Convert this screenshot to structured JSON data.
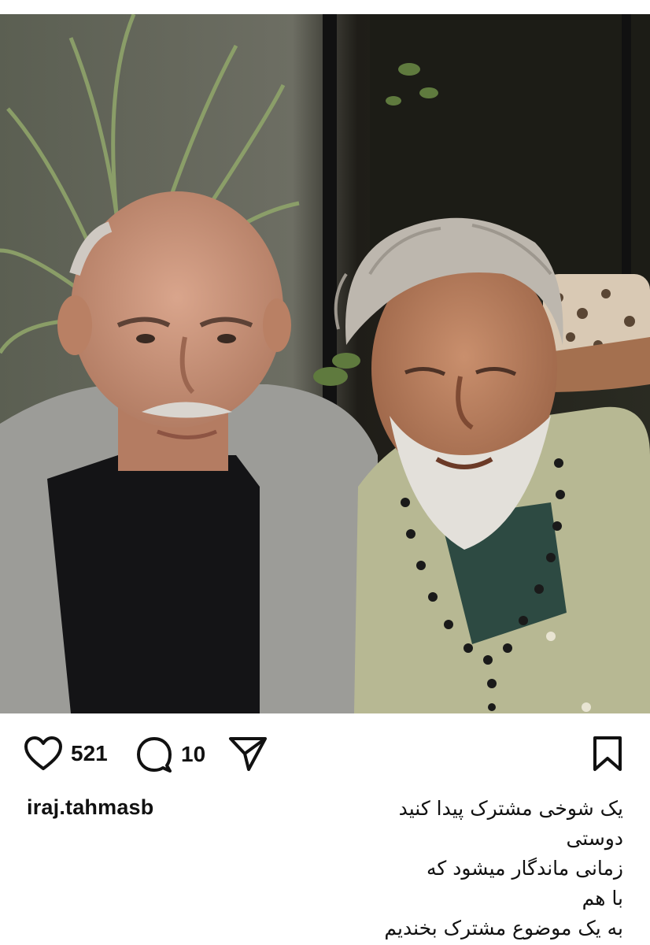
{
  "post": {
    "photo_alt": "Two older men smiling",
    "likes": "521",
    "comments": "10",
    "username": "iraj.tahmasb",
    "caption_lines": [
      "یک شوخی مشترک پیدا کنید",
      "دوستی",
      "زمانی ماندگار میشود که",
      "با هم",
      "به یک موضوع مشترک بخندیم"
    ]
  },
  "icons": {
    "like": "heart-outline-icon",
    "comment": "speech-bubble-icon",
    "share": "paper-plane-icon",
    "save": "bookmark-icon"
  },
  "colors": {
    "text": "#111111",
    "background": "#ffffff"
  }
}
